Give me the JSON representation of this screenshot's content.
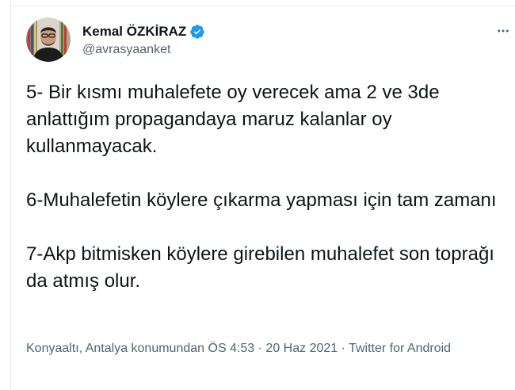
{
  "author": {
    "name": "Kemal ÖZKİRAZ",
    "handle": "@avrasyaanket",
    "verified": true
  },
  "more_icon": "more-dots-icon",
  "tweet": {
    "paragraphs": [
      "5- Bir kısmı muhalefete oy verecek ama 2 ve 3de anlattığım propagandaya maruz kalanlar oy kullanmayacak.",
      "6-Muhalefetin köylere çıkarma yapması için tam zamanı",
      "7-Akp bitmisken köylere girebilen muhalefet son toprağı da atmış olur."
    ]
  },
  "meta": {
    "location": "Konyaaltı, Antalya konumundan",
    "time": "ÖS 4:53",
    "separator_1": " · ",
    "date": "20 Haz 2021",
    "separator_2": " · ",
    "source": "Twitter for Android"
  },
  "colors": {
    "text": "#0f1419",
    "secondary": "#536471",
    "verified_blue": "#1d9bf0",
    "border": "#e1e8ed"
  }
}
